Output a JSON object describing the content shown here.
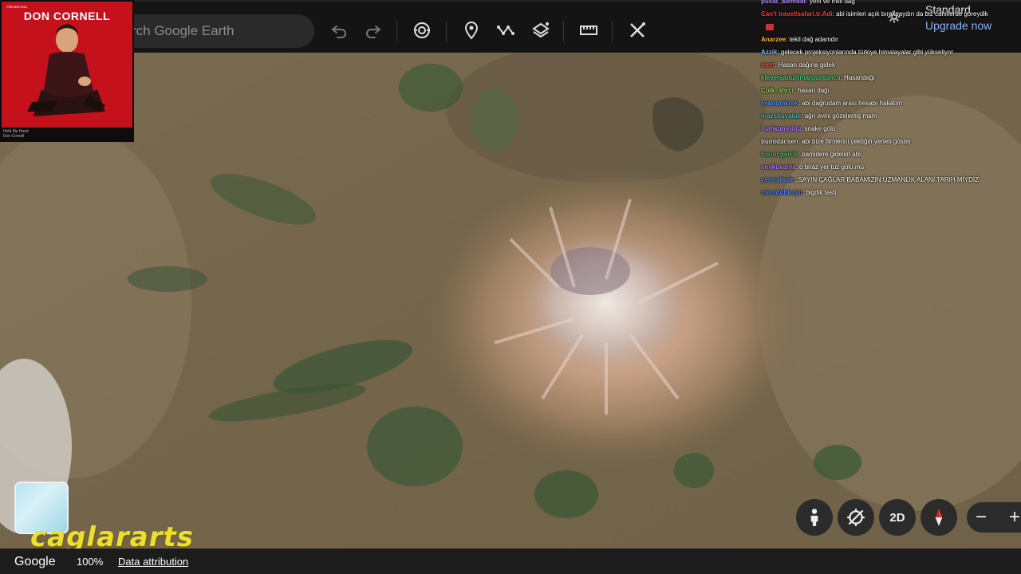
{
  "search": {
    "placeholder": "rch Google Earth"
  },
  "toolbar": {
    "undo_icon": "undo-icon",
    "redo_icon": "redo-icon",
    "voyager_icon": "voyager-icon",
    "placemark_icon": "placemark-icon",
    "path_icon": "path-icon",
    "layers_icon": "layers-icon",
    "measure_icon": "ruler-icon",
    "tools_icon": "tools-icon"
  },
  "album": {
    "tiny_top": "PRESENTING",
    "title": "DON CORNELL",
    "footer_line1": "Hold My Hand",
    "footer_line2": "Don Cornell"
  },
  "header_right": {
    "standard": "Standard",
    "upgrade": "Upgrade now"
  },
  "chat": [
    {
      "user": "pusat_alemdar",
      "color": "#b48bff",
      "text": ": yerli ve milli dağ"
    },
    {
      "user": "Can't travel/safari.tr.Adi",
      "color": "#ff3a3a",
      "text": ": abi isimleri açık bıraksaydın da biz cahillerde goreydik"
    },
    {
      "user": "",
      "color": "#ffffff",
      "text": "",
      "emote": true
    },
    {
      "user": "Anarzee",
      "color": "#ffb347",
      "text": ": tekil dağ adamdır"
    },
    {
      "user": "Azzik",
      "color": "#7fb7ff",
      "text": ": gelecek projeksiyonlarında türkiye himalayalar gibi yükseliyor"
    },
    {
      "user": "mert",
      "color": "#ff4d4d",
      "text": ": Hasan dağına gidek"
    },
    {
      "user": "kleversadullimarguntuncu",
      "color": "#3fd27f",
      "text": ": Hasandağı"
    },
    {
      "user": "Cplk_ahrcr",
      "color": "#8fd14f",
      "text": ": hasan dağı"
    },
    {
      "user": "eekoomkrek",
      "color": "#4d8dff",
      "text": ": abi dağrudam arası hesabı hakatım"
    },
    {
      "user": "mazsbuvaiue",
      "color": "#2fc7c7",
      "text": ": ağrı evini gözelemiş mam"
    },
    {
      "user": "mahkumriolu",
      "color": "#b07bff",
      "text": ": snake gölü"
    },
    {
      "user": "bumidacsen",
      "color": "#d9d9d9",
      "text": ": abi bize filmlerini çektiğin yerleri göster"
    },
    {
      "user": "tosun.geisle",
      "color": "#3fbf6f",
      "text": ": pamidere gidelim abi"
    },
    {
      "user": "emikuvanla",
      "color": "#a77bff",
      "text": ": o biraz yer tuz gölü mü"
    },
    {
      "user": "yemrelinde",
      "color": "#4d8dff",
      "text": ": SAYIN ÇAĞLAR BABAMIZIN UZMANLIK ALANI TARIH MİYDİZ"
    },
    {
      "user": "memduhk.tyb",
      "color": "#4d7dff",
      "text": ": bigdik tasti"
    }
  ],
  "watermark": "caglararts",
  "bottom": {
    "google": "Google",
    "zoom": "100%",
    "attribution": "Data attribution"
  },
  "controls": {
    "pegman_icon": "pegman-icon",
    "recenter_icon": "recenter-icon",
    "view_mode": "2D",
    "compass_icon": "compass-icon",
    "zoom_out": "−",
    "zoom_in": "+"
  },
  "colors": {
    "toolbar_bg": "#141414",
    "watermark": "#ece02c",
    "upgrade_link": "#8ab4f8",
    "compass_needle": "#e53935"
  }
}
